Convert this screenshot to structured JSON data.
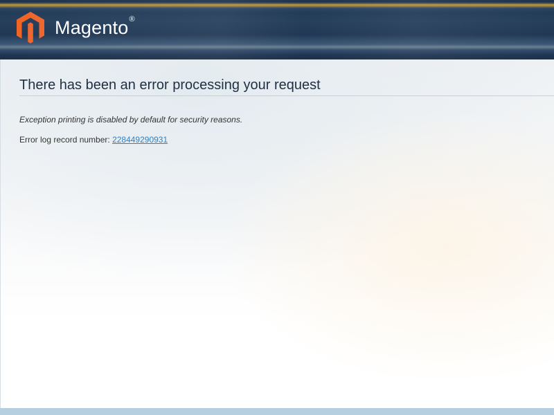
{
  "header": {
    "logo_text": "Magento",
    "logo_registered": "®",
    "logo_icon": "magento-logo-icon",
    "colors": {
      "background": "#1d3350",
      "logo_orange": "#ee672f",
      "logo_text": "#ffffff"
    }
  },
  "main": {
    "title": "There has been an error processing your request",
    "exception_note": "Exception printing is disabled by default for security reasons.",
    "error_log": {
      "label": "Error log record number:",
      "record_number": "228449290931"
    },
    "colors": {
      "link": "#2f7fc0",
      "title": "#1f2f42"
    }
  },
  "footer": {
    "color": "#b6cfe0"
  }
}
